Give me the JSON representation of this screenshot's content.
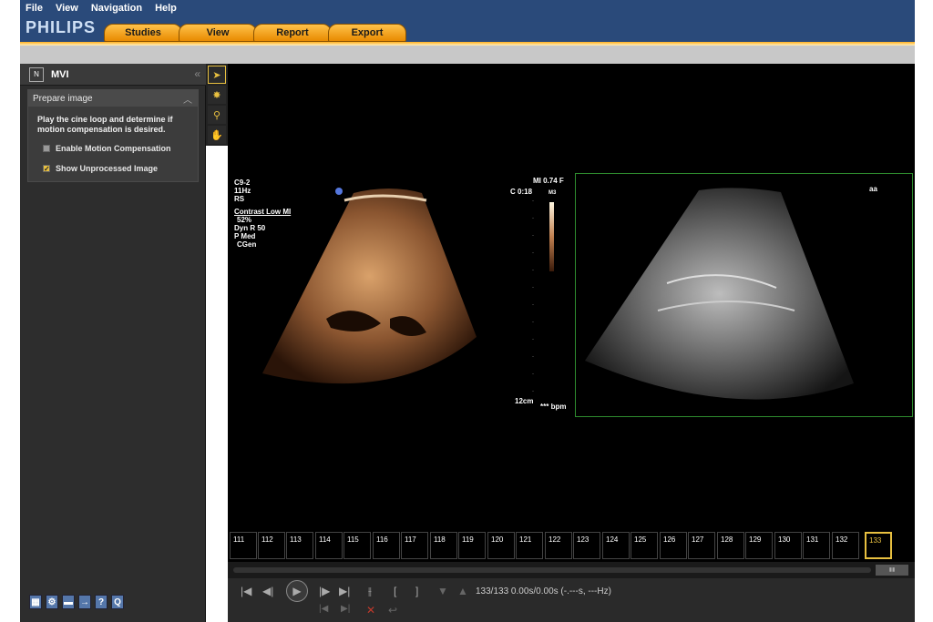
{
  "menu": [
    "File",
    "View",
    "Navigation",
    "Help"
  ],
  "brand": "PHILIPS",
  "tabs": [
    "Studies",
    "View",
    "Report",
    "Export"
  ],
  "panel": {
    "title": "MVI",
    "section": "Prepare image",
    "instruction": "Play the cine loop and determine if motion compensation is desired.",
    "options": [
      {
        "label": "Enable Motion Compensation",
        "checked": false
      },
      {
        "label": "Show Unprocessed Image",
        "checked": true
      }
    ]
  },
  "overlay_left": {
    "probe": "C9-2",
    "rate": "11Hz",
    "rs": "RS",
    "mode": "Contrast Low MI",
    "gain": "52%",
    "dyn": "Dyn R 50",
    "p": "P Med",
    "cgen": "CGen"
  },
  "overlay_right": {
    "mi": "MI 0.74 F",
    "time": "C 0:18",
    "m3": "M3",
    "depth": "12cm",
    "bpm": "*** bpm",
    "corner": "aa"
  },
  "frames": [
    "111",
    "112",
    "113",
    "114",
    "115",
    "116",
    "117",
    "118",
    "119",
    "120",
    "121",
    "122",
    "123",
    "124",
    "125",
    "126",
    "127",
    "128",
    "129",
    "130",
    "131",
    "132",
    "133"
  ],
  "selected_frame": "133",
  "status": "133/133  0.00s/0.00s (-.---s, ---Hz)",
  "bottom_icons": [
    "grid-icon",
    "settings-icon",
    "save-icon",
    "export-icon",
    "help-icon",
    "search-icon"
  ]
}
